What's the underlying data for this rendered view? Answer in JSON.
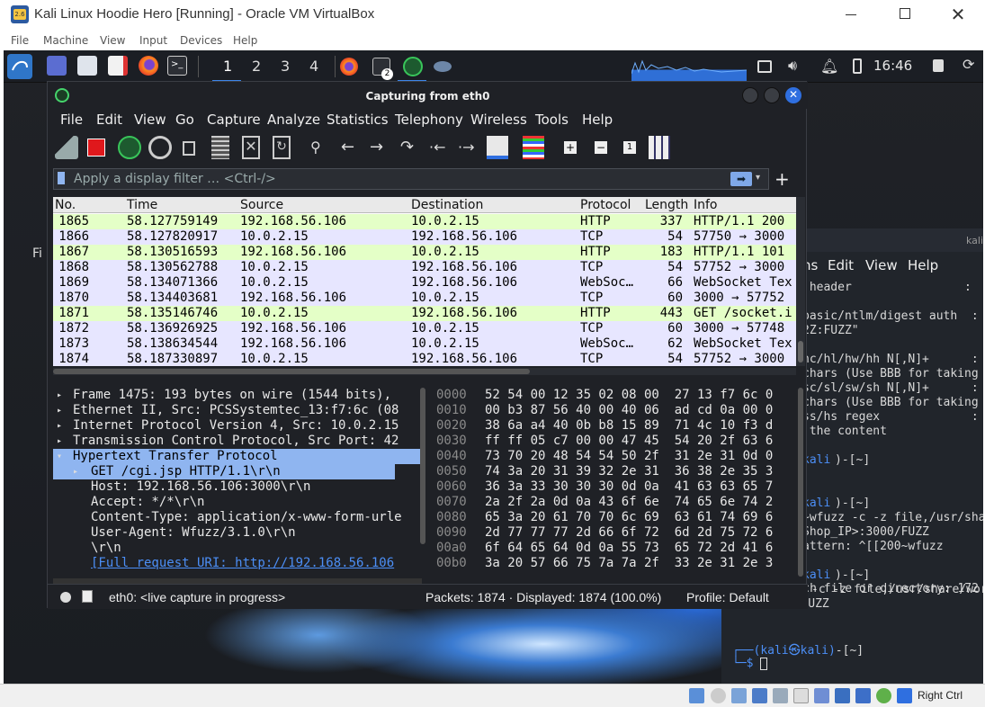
{
  "host": {
    "title": "Kali Linux Hoodie Hero [Running] - Oracle VM VirtualBox",
    "menu": [
      "File",
      "Machine",
      "View",
      "Input",
      "Devices",
      "Help"
    ],
    "host_key": "Right Ctrl"
  },
  "panel": {
    "workspaces": [
      "1",
      "2",
      "3",
      "4"
    ],
    "clock": "16:46",
    "terminal_badge": "2"
  },
  "desktop": {
    "partial_label": "Fi"
  },
  "wireshark": {
    "title": "Capturing from eth0",
    "menu": [
      "File",
      "Edit",
      "View",
      "Go",
      "Capture",
      "Analyze",
      "Statistics",
      "Telephony",
      "Wireless",
      "Tools",
      "Help"
    ],
    "filter_placeholder": "Apply a display filter … <Ctrl-/>",
    "columns": [
      "No.",
      "Time",
      "Source",
      "Destination",
      "Protocol",
      "Length",
      "Info"
    ],
    "packets": [
      {
        "no": "1865",
        "time": "58.127759149",
        "src": "192.168.56.106",
        "dst": "10.0.2.15",
        "proto": "HTTP",
        "len": "337",
        "info": "HTTP/1.1 200",
        "cls": "c-http"
      },
      {
        "no": "1866",
        "time": "58.127820917",
        "src": "10.0.2.15",
        "dst": "192.168.56.106",
        "proto": "TCP",
        "len": "54",
        "info": "57750 → 3000",
        "cls": "c-tcp"
      },
      {
        "no": "1867",
        "time": "58.130516593",
        "src": "192.168.56.106",
        "dst": "10.0.2.15",
        "proto": "HTTP",
        "len": "183",
        "info": "HTTP/1.1 101",
        "cls": "c-http"
      },
      {
        "no": "1868",
        "time": "58.130562788",
        "src": "10.0.2.15",
        "dst": "192.168.56.106",
        "proto": "TCP",
        "len": "54",
        "info": "57752 → 3000",
        "cls": "c-tcp"
      },
      {
        "no": "1869",
        "time": "58.134071366",
        "src": "10.0.2.15",
        "dst": "192.168.56.106",
        "proto": "WebSoc…",
        "len": "66",
        "info": "WebSocket Tex",
        "cls": "c-ws"
      },
      {
        "no": "1870",
        "time": "58.134403681",
        "src": "192.168.56.106",
        "dst": "10.0.2.15",
        "proto": "TCP",
        "len": "60",
        "info": "3000 → 57752",
        "cls": "c-tcp"
      },
      {
        "no": "1871",
        "time": "58.135146746",
        "src": "10.0.2.15",
        "dst": "192.168.56.106",
        "proto": "HTTP",
        "len": "443",
        "info": "GET /socket.i",
        "cls": "c-http"
      },
      {
        "no": "1872",
        "time": "58.136926925",
        "src": "192.168.56.106",
        "dst": "10.0.2.15",
        "proto": "TCP",
        "len": "60",
        "info": "3000 → 57748",
        "cls": "c-tcp"
      },
      {
        "no": "1873",
        "time": "58.138634544",
        "src": "192.168.56.106",
        "dst": "10.0.2.15",
        "proto": "WebSoc…",
        "len": "62",
        "info": "WebSocket Tex",
        "cls": "c-ws"
      },
      {
        "no": "1874",
        "time": "58.187330897",
        "src": "10.0.2.15",
        "dst": "192.168.56.106",
        "proto": "TCP",
        "len": "54",
        "info": "57752 → 3000",
        "cls": "c-tcp"
      }
    ],
    "details": [
      "Frame 1475: 193 bytes on wire (1544 bits),",
      "Ethernet II, Src: PCSSystemtec_13:f7:6c (08",
      "Internet Protocol Version 4, Src: 10.0.2.15",
      "Transmission Control Protocol, Src Port: 42",
      "Hypertext Transfer Protocol",
      "GET /cgi.jsp HTTP/1.1\\r\\n",
      "Host: 192.168.56.106:3000\\r\\n",
      "Accept: */*\\r\\n",
      "Content-Type: application/x-www-form-urle",
      "User-Agent: Wfuzz/3.1.0\\r\\n",
      "\\r\\n",
      "[Full request URI: http://192.168.56.106"
    ],
    "bytes": [
      {
        "off": "0000",
        "hex": "52 54 00 12 35 02 08 00  27 13 f7 6c 0"
      },
      {
        "off": "0010",
        "hex": "00 b3 87 56 40 00 40 06  ad cd 0a 00 0"
      },
      {
        "off": "0020",
        "hex": "38 6a a4 40 0b b8 15 89  71 4c 10 f3 d"
      },
      {
        "off": "0030",
        "hex": "ff ff 05 c7 00 00 47 45  54 20 2f 63 6"
      },
      {
        "off": "0040",
        "hex": "73 70 20 48 54 54 50 2f  31 2e 31 0d 0"
      },
      {
        "off": "0050",
        "hex": "74 3a 20 31 39 32 2e 31  36 38 2e 35 3"
      },
      {
        "off": "0060",
        "hex": "36 3a 33 30 30 30 0d 0a  41 63 63 65 7"
      },
      {
        "off": "0070",
        "hex": "2a 2f 2a 0d 0a 43 6f 6e  74 65 6e 74 2"
      },
      {
        "off": "0080",
        "hex": "65 3a 20 61 70 70 6c 69  63 61 74 69 6"
      },
      {
        "off": "0090",
        "hex": "2d 77 77 77 2d 66 6f 72  6d 2d 75 72 6"
      },
      {
        "off": "00a0",
        "hex": "6f 64 65 64 0d 0a 55 73  65 72 2d 41 6"
      },
      {
        "off": "00b0",
        "hex": "3a 20 57 66 75 7a 7a 2f  33 2e 31 2e 3"
      }
    ],
    "status": {
      "iface": "eth0: <live capture in progress>",
      "packets": "Packets: 1874 · Displayed: 1874 (100.0%)",
      "profile": "Profile: Default"
    }
  },
  "terminal": {
    "menu": [
      "ns",
      "Edit",
      "View",
      "Help"
    ],
    "head_label": "kali",
    "lines": [
      " header                :",
      "",
      "basic/ntlm/digest auth  :",
      "2Z:FUZZ\"",
      "",
      "nc/hl/hw/hh N[,N]+      :",
      "chars (Use BBB for taking",
      "sc/sl/sw/sh N[,N]+      :",
      "chars (Use BBB for taking",
      "ss/hs regex             :",
      " the content",
      "",
      "",
      "",
      "",
      "",
      "~wfuzz -c -z file,/usr/sha",
      "Shop_IP>:3000/FUZZ",
      "attern: ^[[200~wfuzz",
      "",
      "",
      "",
      "-c -z file,/usr/share/wor",
      "2.2:3000/FUZZ",
      "zsh: no such file or directory: 172"
    ],
    "prompt_user": "kali",
    "prompt_host": "kali",
    "prompt_dir": "~"
  }
}
